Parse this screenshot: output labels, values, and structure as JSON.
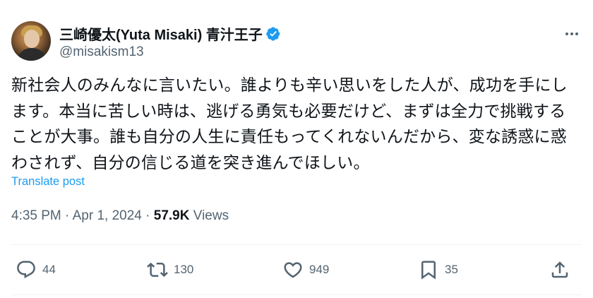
{
  "author": {
    "display_name": "三崎優太(Yuta Misaki) 青汁王子",
    "handle": "@misakism13",
    "verified": true,
    "verified_color": "#1d9bf0",
    "avatar_icon": "profile-photo"
  },
  "tweet": {
    "text": "新社会人のみんなに言いたい。誰よりも辛い思いをした人が、成功を手にします。本当に苦しい時は、逃げる勇気も必要だけど、まずは全力で挑戦することが大事。誰も自分の人生に責任もってくれないんだから、変な誘惑に惑わされず、自分の信じる道を突き進んでほしい。",
    "translate_label": "Translate post",
    "time": "4:35 PM",
    "date": "Apr 1, 2024",
    "separator": "·",
    "views_count": "57.9K",
    "views_label": "Views"
  },
  "actions": {
    "reply_count": "44",
    "retweet_count": "130",
    "like_count": "949",
    "bookmark_count": "35"
  },
  "colors": {
    "text": "#0f1419",
    "secondary": "#536471",
    "link": "#1d9bf0",
    "divider": "#eff3f4"
  }
}
